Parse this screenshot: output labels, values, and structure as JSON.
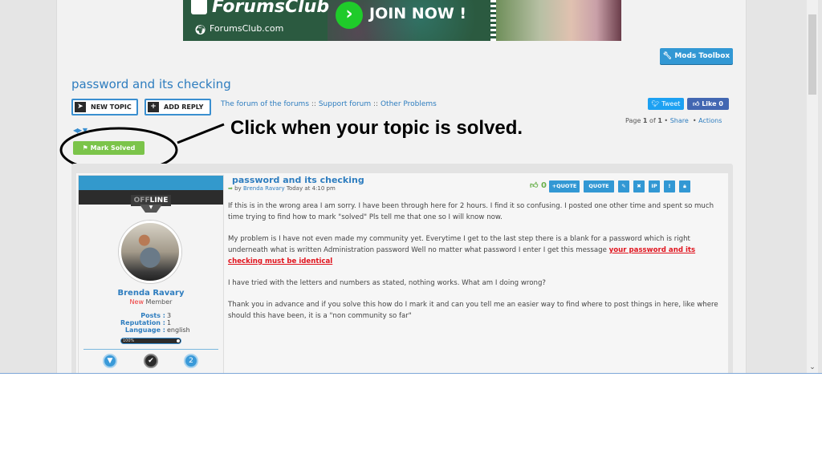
{
  "banner": {
    "brand": "ForumsClub",
    "url": "ForumsClub.com",
    "cta": "JOIN NOW !"
  },
  "toolbar": {
    "mods_toolbox": "Mods Toolbox",
    "new_topic": "NEW TOPIC",
    "add_reply": "ADD REPLY"
  },
  "topic": {
    "title": "password and its checking"
  },
  "breadcrumb": [
    "The forum of the forums",
    "Support forum",
    "Other Problems"
  ],
  "breadcrumb_sep": "::",
  "social": {
    "tweet": "Tweet",
    "like": "Like 0"
  },
  "pagination": {
    "prefix": "Page",
    "current": "1",
    "of": "of",
    "total": "1",
    "share": "Share",
    "actions": "Actions"
  },
  "mark_solved": "Mark Solved",
  "annotation": {
    "text": "Click when your topic is solved."
  },
  "profile": {
    "status_off": "OFF",
    "status_line": "LINE",
    "username": "Brenda Ravary",
    "rank_new": "New",
    "rank_rest": "Member",
    "stats": [
      {
        "label": "Posts :",
        "value": "3"
      },
      {
        "label": "Reputation :",
        "value": "1"
      },
      {
        "label": "Language :",
        "value": "english"
      }
    ],
    "progress_label": "100%",
    "progress_percent": 100
  },
  "post": {
    "title": "password and its checking",
    "by": "by",
    "author": "Brenda Ravary",
    "time": "Today at 4:10 pm",
    "likes": "0",
    "actions": [
      "+QUOTE",
      "QUOTE",
      "edit",
      "delete",
      "IP",
      "!",
      "lock"
    ],
    "paragraphs": [
      "If this is in the wrong area I am sorry. I have been through here for 2 hours. I find it so confusing. I posted one other time and spent so much time trying to find how to mark \"solved\" Pls tell me that one so I will know now.",
      "My problem is I have not even made my community yet. Everytime I get to the last step there is a blank for a password which is right underneath what is written Administration password Well no matter what password I enter I get this message",
      "I have tried with the letters and numbers as stated, nothing works. What am I doing wrong?",
      "Thank you in advance and if you solve this how do I mark it and can you tell me an easier way to find where to post things in here, like where should this have been, it is a \"non community so far\""
    ],
    "highlight": "your password and its checking must be identical"
  },
  "colors": {
    "accent": "#3298d4",
    "link": "#2e7dbf",
    "solved": "#7bc44a",
    "error": "#e0141e",
    "banner": "#2b5a40"
  }
}
